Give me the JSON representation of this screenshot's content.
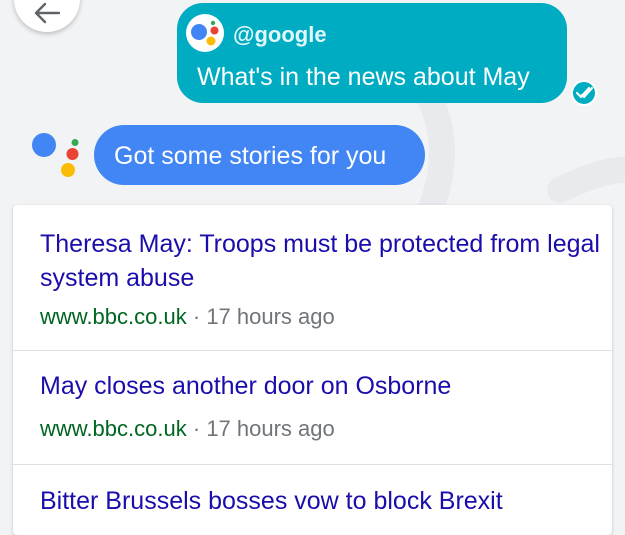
{
  "colors": {
    "background": "#f1f3f4",
    "user_bubble": "#00acc1",
    "assistant_bubble": "#4285f4",
    "headline_link": "#1a0dab",
    "source_url": "#006621",
    "meta_gray": "#70757a"
  },
  "header": {
    "back_icon": "arrow-left-icon"
  },
  "user_message": {
    "handle": "@google",
    "text": "What's in the news about May",
    "status_icon": "double-check-icon"
  },
  "assistant_message": {
    "logo_icon": "google-assistant-logo-icon",
    "text": "Got some stories for you"
  },
  "news": {
    "separator": "·",
    "items": [
      {
        "title": "Theresa May: Troops must be protected from legal system abuse",
        "source": "www.bbc.co.uk",
        "time": "17 hours ago"
      },
      {
        "title": "May closes another door on Osborne",
        "source": "www.bbc.co.uk",
        "time": "17 hours ago"
      },
      {
        "title": "Bitter Brussels bosses vow to block Brexit"
      }
    ]
  }
}
